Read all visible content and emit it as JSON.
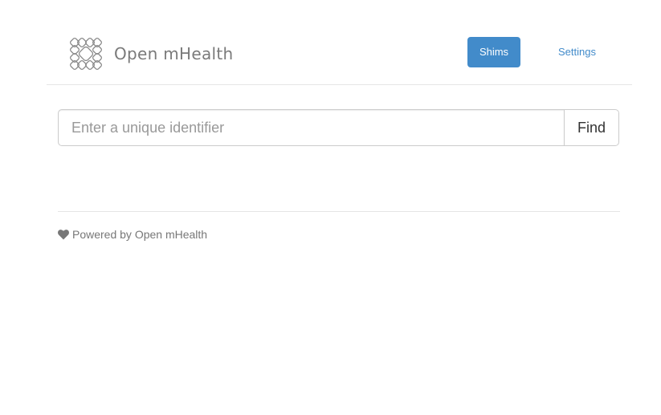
{
  "header": {
    "brand": {
      "logo_icon": "open-mhealth-logo",
      "name": "Open mHealth"
    },
    "nav": {
      "shims_label": "Shims",
      "settings_label": "Settings"
    }
  },
  "search": {
    "placeholder": "Enter a unique identifier",
    "value": "",
    "button_label": "Find"
  },
  "footer": {
    "icon": "heart-icon",
    "text": "Powered by Open mHealth"
  },
  "colors": {
    "accent": "#428bca",
    "logo": "#8a8a8a",
    "muted_text": "#777777"
  }
}
